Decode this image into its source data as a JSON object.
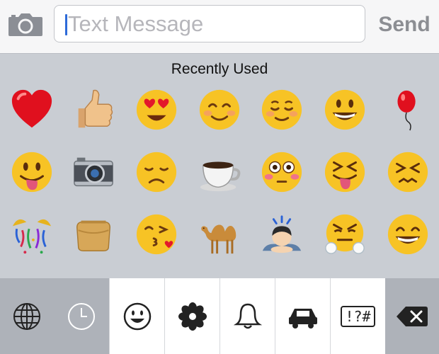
{
  "compose": {
    "camera_icon": "camera-icon",
    "placeholder": "Text Message",
    "send_label": "Send"
  },
  "emoji_panel": {
    "section_title": "Recently Used",
    "emojis": [
      "red-heart",
      "thumbs-up",
      "heart-eyes-face",
      "smiling-face",
      "blushing-smile-face",
      "grinning-face",
      "balloon",
      "tongue-out-face",
      "camera",
      "disappointed-face",
      "hot-beverage",
      "flushed-face",
      "squinting-tongue-face",
      "confounded-face",
      "confetti-ball",
      "pouch",
      "kissing-face",
      "camel",
      "bowing-person",
      "triumph-face",
      "grinning-smiling-eyes-face"
    ]
  },
  "category_bar": {
    "items": [
      "globe-icon",
      "clock-icon",
      "smiley-icon",
      "flower-icon",
      "bell-icon",
      "car-icon",
      "symbols-icon",
      "backspace-icon"
    ],
    "symbols_label": "!?#"
  },
  "colors": {
    "caret": "#2d6ad8",
    "placeholder": "#b6b6bb",
    "send": "#8c8e93",
    "panel_bg": "#c9cdd3",
    "emoji_yellow": "#f7c325"
  }
}
